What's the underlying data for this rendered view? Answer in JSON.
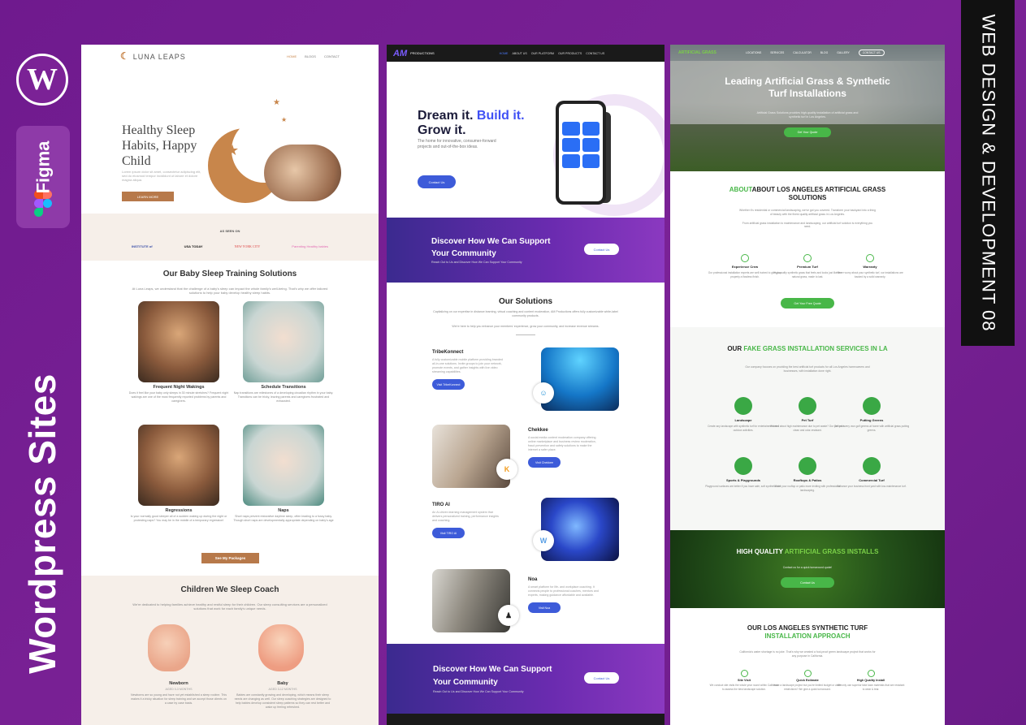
{
  "brand": {
    "left_vertical_title": "Wordpress Sites",
    "figma_label": "Figma",
    "right_banner": "WEB DESIGN & DEVELOPMENT   08",
    "wp_icon": "wordpress-icon",
    "accent_purple": "#7b2296"
  },
  "luna": {
    "logo": "LUNA LEAPS",
    "nav": [
      "HOME",
      "BLOGS",
      "CONTACT"
    ],
    "hero_title": "Healthy Sleep Habits, Happy Child",
    "hero_sub": "Lorem ipsum dolor sit amet, consectetur adipiscing elit, sed do eiusmod tempor incididunt ut labore et dolore magna aliqua.",
    "hero_button": "LEARN MORE",
    "as_seen_on": "AS SEEN ON",
    "press": [
      "INSTITUTE of",
      "USA TODAY",
      "NEW YORK CITY",
      "Parenting Healthy babies"
    ],
    "solutions_title": "Our Baby Sleep Training Solutions",
    "solutions_text": "At Luna Leaps, we understand that the challenge of a baby's sleep can impact the whole family's well-being. That's why we offer tailored solutions to help your baby develop healthy sleep habits.",
    "cards": [
      {
        "title": "Frequent Night Wakings",
        "text": "Does it feel like your baby only sleeps in 30 minute stretches? Frequent night wakings are one of the most frequently reported problems by parents and caregivers."
      },
      {
        "title": "Schedule Transitions",
        "text": "Nap transitions are milestones of a developing circadian rhythm in your baby. Transitions can be tricky, leaving parents and caregivers frustrated and exhausted."
      },
      {
        "title": "Regressions",
        "text": "Is your normally good sleeper all of a sudden waking up during the night or protesting naps? You may be in the middle of a temporary regression!"
      },
      {
        "title": "Naps",
        "text": "Short naps prevent restorative daytime sleep, often leading to a fussy baby. Though short naps are developmentally appropriate depending on baby's age"
      }
    ],
    "packages_button": "See My Packages",
    "coach_title": "Children We Sleep Coach",
    "coach_text": "We're dedicated to helping families achieve healthy and restful sleep for their children. Our sleep consulting services are a personalized solutions that work for each family's unique needs.",
    "coach": [
      {
        "title": "Newborn",
        "age": "AGED 0-3 MONTHS",
        "text": "Newborns are so young and have not yet established a sleep routine. This makes it a tricky situation for sleep training and we accept those clients on a case by case basis."
      },
      {
        "title": "Baby",
        "age": "AGED 3-12 MONTHS",
        "text": "Babies are constantly growing and developing, which means their sleep needs are changing as well. Our sleep coaching strategies are designed to help babies develop consistent sleep patterns so they can rest better and wake up feeling refreshed."
      }
    ]
  },
  "am": {
    "logo": "PRODUCTIONS",
    "nav": [
      "HOME",
      "ABOUT US",
      "OUR PLATFORM",
      "OUR PRODUCTS",
      "CONTACT US"
    ],
    "hero_plain": "Dream it. ",
    "hero_blue": "Build it.",
    "hero_line2": "Grow it.",
    "hero_sub": "The home for innovative, consumer-forward projects and out-of-the-box ideas.",
    "hero_button": "Contact Us",
    "band_title": "Discover How We Can Support Your Community",
    "band_text": "Reach Out to Us and Discover How We Can Support Your Community",
    "band_button": "Contact Us",
    "solutions_title": "Our Solutions",
    "solutions_text": "Capitalizing on our expertise in distance learning, virtual coaching and content moderation, AM Productions offers fully customizable white-label community products.",
    "solutions_text2": "We're here to help you enhance your members' experience, grow your community, and increase revenue streams.",
    "items": [
      {
        "title": "TribeKonnect",
        "text": "A fully customizable mobile platform providing branded all-in-one solutions. Invite groups to join your network, promote events, and gather insights with live video streaming capabilities.",
        "button": "Visit TribeKonnect"
      },
      {
        "title": "Chekkee",
        "text": "A social media content moderation company offering online marketplace and business review moderation, fraud prevention and safety solutions to make the internet a safer place.",
        "button": "Visit Chekkee"
      },
      {
        "title": "TIRO AI",
        "text": "An AI-driven learning management system that delivers personalized training, performance insights and coaching.",
        "button": "Visit TIRO AI"
      },
      {
        "title": "Noa",
        "text": "A smart platform for life- and workplace coaching. It connects people to professional coaches, mentors and experts, making guidance affordable and available.",
        "button": "Visit Noa"
      }
    ],
    "band2_title": "Discover How We Can Support Your Community",
    "band2_text": "Reach Out to Us and Discover How We Can Support Your Community",
    "band2_button": "Contact Us"
  },
  "grass": {
    "logo": "ARTIFICIAL GRASS",
    "nav": [
      "LOCATIONS",
      "SERVICES",
      "CALCULATOR",
      "BLOG",
      "GALLERY",
      "CONTACT US"
    ],
    "hero_title": "Leading Artificial Grass & Synthetic Turf Installations",
    "hero_sub": "Artificial Grass Solutions provides high-quality installation of artificial grass and synthetic turf in Los Angeles.",
    "hero_button": "Get Your Quote",
    "about_green": "ABOUT",
    "about_title": "ABOUT LOS ANGELES ARTIFICIAL GRASS SOLUTIONS",
    "about_text": "Whether it's residential or commercial landscaping, we've got you covered. Transform your backyard into a thing of beauty with the finest quality artificial grass in Los Angeles.",
    "about_text2": "From artificial grass installation to maintenance and landscaping, our artificial turf solution is everything you need.",
    "features": [
      {
        "title": "Experience Crew",
        "text": "Our professional installation experts are well trained to give your property a flawless finish."
      },
      {
        "title": "Premium Turf",
        "text": "High-quality synthetic grass that feels and looks just like the natural grass, made to last."
      },
      {
        "title": "Warranty",
        "text": "Never worry about your synthetic turf, our installations are backed by a solid warranty."
      }
    ],
    "about_button": "Get Your Free Quote",
    "svc_plain": "OUR ",
    "svc_green": "FAKE GRASS INSTALLATION SERVICES IN LA",
    "svc_text": "Our company focuses on providing the best artificial turf products for all Los Angeles homeowners and businesses, with installation done right.",
    "services": [
      {
        "title": "Landscape",
        "text": "Create any landscape with synthetic turf for entertainment and outdoor activities."
      },
      {
        "title": "Pet Turf",
        "text": "Worried about high maintenance due to pet waste? Our pet turf is clean and odor-resistant."
      },
      {
        "title": "Putting Greens",
        "text": "Get your very own golf greens at home with artificial grass putting greens."
      },
      {
        "title": "Sports & Playgrounds",
        "text": "Playground surfaces are better if you have safe, soft synthetic turf."
      },
      {
        "title": "Rooftops & Patios",
        "text": "Make your rooftop or patio more inviting with professional landscaping."
      },
      {
        "title": "Commercial Turf",
        "text": "Enhance your business front yard with low-maintenance turf."
      }
    ],
    "quality_plain": "HIGH QUALITY ",
    "quality_green": "ARTIFICIAL GRASS INSTALLS",
    "quality_text": "Contact us for a quick turnaround quote!",
    "quality_button": "Contact Us",
    "approach_title": "OUR LOS ANGELES SYNTHETIC TURF",
    "approach_green": "INSTALLATION APPROACH",
    "approach_text": "California's water shortage is no joke. That's why we created a fool-proof green landscape project that works for any purpose in California.",
    "steps": [
      {
        "title": "Site Visit",
        "text": "We conduct site visits the whole year round within California to assess the best landscape solution."
      },
      {
        "title": "Quick Estimate",
        "text": "Have a landscape project but you're limited budget or water restrictions? We give a quick turnaround."
      },
      {
        "title": "High Quality Install",
        "text": "We only use superior fake lawn materials that are resistant to wear & tear."
      }
    ]
  }
}
